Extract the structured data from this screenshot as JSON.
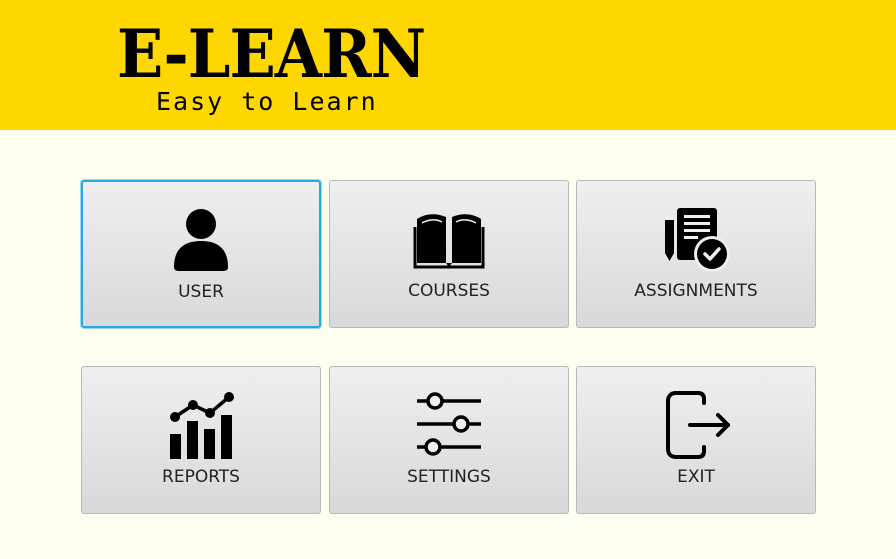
{
  "header": {
    "title": "E-LEARN",
    "tagline": "Easy to Learn",
    "background_color": "#ffd700"
  },
  "menu": {
    "tiles": [
      {
        "label": "USER",
        "icon": "user-icon",
        "focused": true
      },
      {
        "label": "COURSES",
        "icon": "book-icon"
      },
      {
        "label": "ASSIGNMENTS",
        "icon": "assignment-icon"
      },
      {
        "label": "REPORTS",
        "icon": "chart-icon"
      },
      {
        "label": "SETTINGS",
        "icon": "sliders-icon"
      },
      {
        "label": "EXIT",
        "icon": "exit-icon"
      }
    ]
  },
  "colors": {
    "page_background": "#fffff0",
    "focus_border": "#29a8e0"
  }
}
